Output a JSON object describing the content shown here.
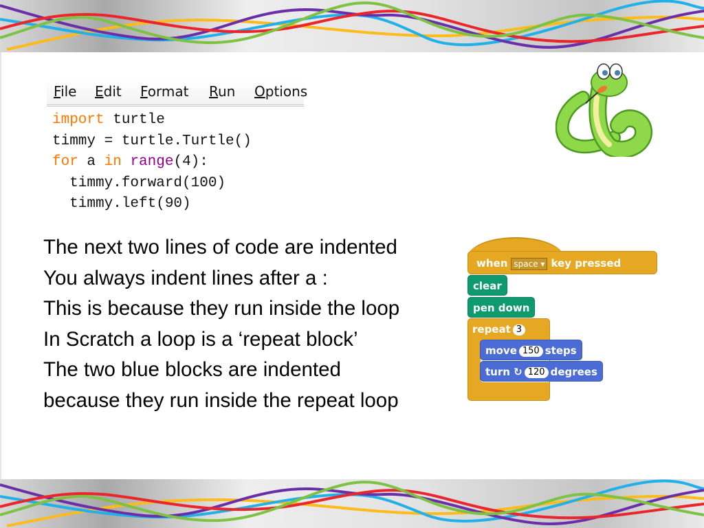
{
  "slide": {
    "decoration": {
      "ribbon_colors": [
        "#e8262c",
        "#22b0e8",
        "#6a2fa8",
        "#7dc242",
        "#fdbb1c"
      ],
      "background_color": "#ffffff"
    },
    "idle_window": {
      "menu": [
        "File",
        "Edit",
        "Format",
        "Run",
        "Options"
      ],
      "code_lines": [
        [
          {
            "t": "import",
            "c": "kw"
          },
          {
            "t": " turtle",
            "c": ""
          }
        ],
        [
          {
            "t": "timmy = turtle.Turtle()",
            "c": ""
          }
        ],
        [
          {
            "t": "for",
            "c": "kw"
          },
          {
            "t": " a ",
            "c": ""
          },
          {
            "t": "in",
            "c": "kw"
          },
          {
            "t": " ",
            "c": ""
          },
          {
            "t": "range",
            "c": "bi"
          },
          {
            "t": "(4):",
            "c": ""
          }
        ],
        [
          {
            "t": "  timmy.forward(100)",
            "c": ""
          }
        ],
        [
          {
            "t": "  timmy.left(90)",
            "c": ""
          }
        ]
      ],
      "syntax_colors": {
        "keyword": "#ff7700",
        "builtin": "#900090",
        "default": "#111111"
      }
    },
    "mascot": {
      "icon": "python-snake-mascot-icon"
    },
    "body_lines": [
      "The next two lines of code are indented",
      "You always indent lines after a :",
      "This is because they run inside the loop",
      "In Scratch a loop is a ‘repeat block’",
      "The two blue blocks are indented",
      "because they run inside the repeat loop"
    ],
    "scratch": {
      "hat": {
        "when": "when",
        "key": "space",
        "pressed": "key pressed"
      },
      "clear": "clear",
      "pen_down": "pen down",
      "repeat": {
        "label": "repeat",
        "count": "3"
      },
      "move": {
        "label": "move",
        "steps": "150",
        "suffix": "steps"
      },
      "turn": {
        "label": "turn",
        "icon": "rotate-clockwise-icon",
        "degrees": "120",
        "suffix": "degrees"
      },
      "colors": {
        "events": "#e6a822",
        "pen": "#0e9a6c",
        "motion": "#4a6cd4"
      }
    }
  }
}
